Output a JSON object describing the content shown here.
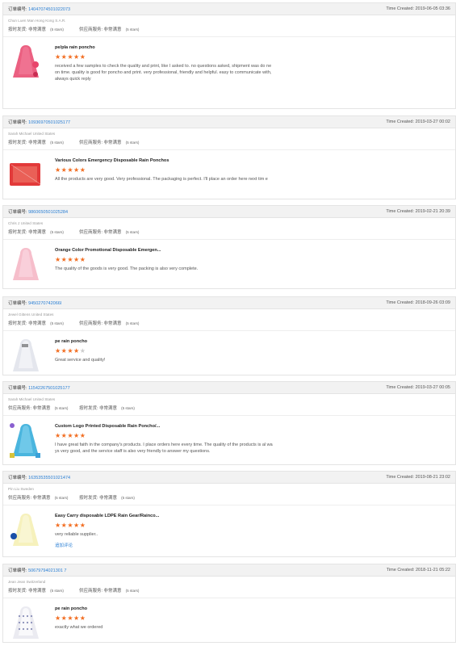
{
  "labels": {
    "order_label": "订单编号:",
    "time_label": "Time Created:"
  },
  "colors": {
    "link": "#2a7fd4",
    "star": "#f26d21",
    "header_bg": "#f2f2f2"
  },
  "reviews": [
    {
      "order_no": "14047074501022073",
      "time": "2019-06-05 03:36",
      "buyer": "Chun Luen Man  Hong Kong S.A.R.",
      "rating_a_label": "按时发货: 非常满意",
      "rating_a_stars": "(5 stars)",
      "rating_b_label": "供应商服务: 非常满意",
      "rating_b_stars": "(5 stars)",
      "product": "pe/pla rain poncho",
      "stars": 5,
      "comment": "received a few samples to check the quality and print, like I asked to. no questions asked, shipment was do ne on time. quality is good for poncho and print. very professional, friendly and helpful. easy to communicate with, always quick reply",
      "thumb_icon": "red-poncho-icon"
    },
    {
      "order_no": "10936970501025177",
      "time": "2019-03-27 00:02",
      "buyer": "Sarah Michael  United States",
      "rating_a_label": "按时发货: 非常满意",
      "rating_a_stars": "(5 stars)",
      "rating_b_label": "供应商服务: 非常满意",
      "rating_b_stars": "(5 stars)",
      "product": "Various Colors Emergency Disposable Rain Ponchos",
      "stars": 5,
      "comment": "All the products are very good. Very professional. The packaging is perfect. I'll place an order here next tim e",
      "thumb_icon": "red-poncho-pack-icon"
    },
    {
      "order_no": "9860650501025284",
      "time": "2019-02-21 20:39",
      "buyer": "Chris J  United States",
      "rating_a_label": "按时发货: 非常满意",
      "rating_a_stars": "(5 stars)",
      "rating_b_label": "供应商服务: 非常满意",
      "rating_b_stars": "(5 stars)",
      "product": "Orange Color Promotional Disposable Emergen...",
      "stars": 5,
      "comment": "The quality of the goods is very good. The packing is also very complete.",
      "thumb_icon": "pink-poncho-icon"
    },
    {
      "order_no": "9450270742066I",
      "time": "2018-09-26 03:09",
      "buyer": "Jewel Gittens  United States",
      "rating_a_label": "按时发货: 非常满意",
      "rating_a_stars": "(5 stars)",
      "rating_b_label": "供应商服务: 非常满意",
      "rating_b_stars": "(5 stars)",
      "product": "pe rain poncho",
      "stars": 4,
      "comment": "Great service and quality!",
      "thumb_icon": "white-poncho-icon"
    },
    {
      "order_no": "11542267501025177",
      "time": "2019-03-27 00:05",
      "buyer": "Sarah Michael  United States",
      "rating_a_label": "供应商服务: 非常满意",
      "rating_a_stars": "(5 stars)",
      "rating_b_label": "按时发货: 非常满意",
      "rating_b_stars": "(5 stars)",
      "product": "Custom Logo Printed Disposable Rain Poncho/...",
      "stars": 5,
      "comment": "I have great faith in the company's products. I place orders here every time. The quality of the products is al ways very good, and the service staff is also very friendly to answer my questions.",
      "thumb_icon": "blue-poncho-icon"
    },
    {
      "order_no": "16353535501021474",
      "time": "2019-08-21 23:02",
      "buyer": "Pin Liu  Sweden",
      "rating_a_label": "供应商服务: 非常满意",
      "rating_a_stars": "(5 stars)",
      "rating_b_label": "按时发货: 非常满意",
      "rating_b_stars": "(5 stars)",
      "product": "Easy Carry disposable LDPE Rain Gear/Rainco...",
      "stars": 5,
      "comment": "very reliable supplier..",
      "append_link": "追加评论",
      "thumb_icon": "clear-poncho-icon"
    },
    {
      "order_no": "50679794021301 7",
      "time": "2018-11-21 05:22",
      "buyer": "Jean Jean  Switzerland",
      "rating_a_label": "按时发货: 非常满意",
      "rating_a_stars": "(5 stars)",
      "rating_b_label": "供应商服务: 非常满意",
      "rating_b_stars": "(5 stars)",
      "product": "pe rain poncho",
      "stars": 5,
      "comment": "exactly what we ordered",
      "thumb_icon": "dotted-poncho-icon"
    }
  ]
}
